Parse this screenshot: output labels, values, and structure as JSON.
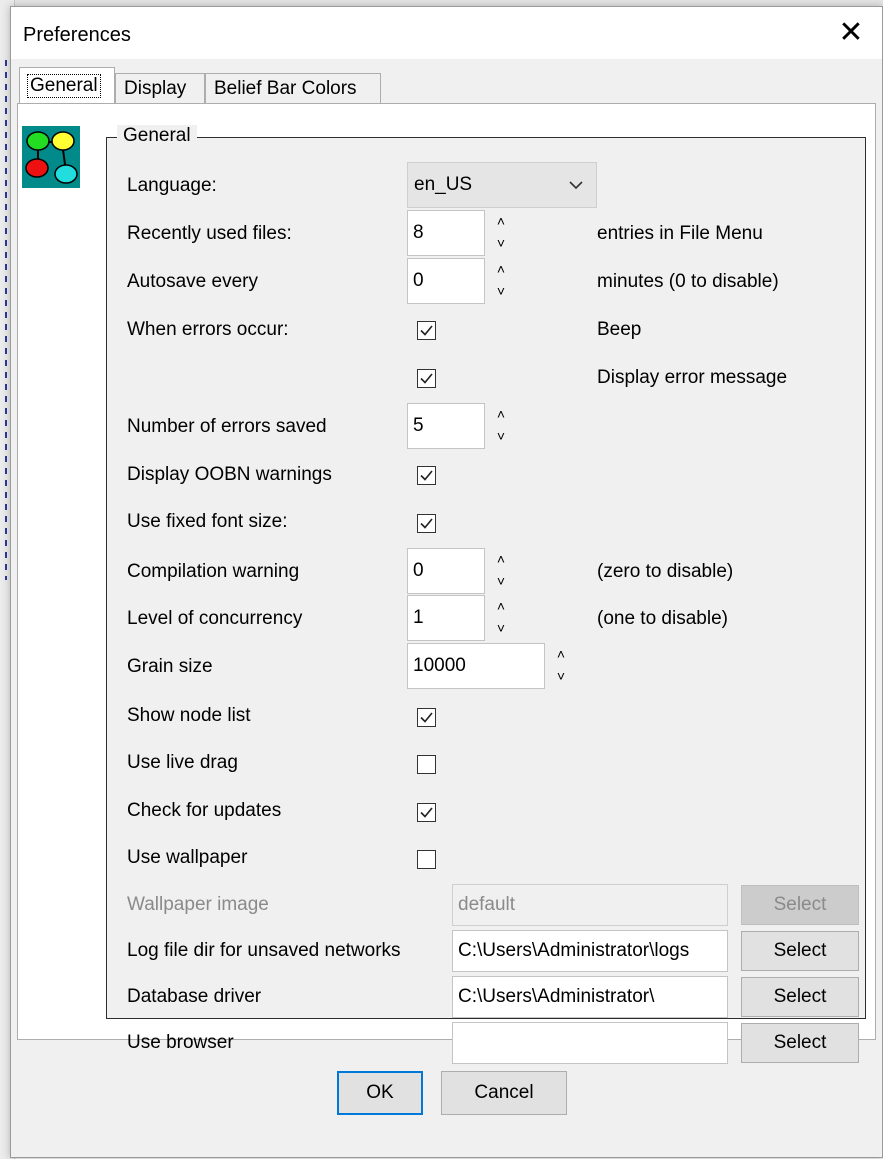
{
  "window": {
    "title": "Preferences",
    "close_glyph": "✕"
  },
  "tabs": [
    {
      "label": "General",
      "active": true
    },
    {
      "label": "Display",
      "active": false
    },
    {
      "label": "Belief Bar Colors",
      "active": false
    }
  ],
  "group": {
    "legend": "General",
    "language": {
      "label": "Language:",
      "value": "en_US",
      "icon": "chevron-down-icon"
    },
    "recent_files": {
      "label": "Recently used files:",
      "value": "8",
      "note": "entries in File Menu"
    },
    "autosave": {
      "label": "Autosave every",
      "value": "0",
      "note": "minutes (0 to disable)"
    },
    "errors_occur": {
      "label": "When errors occur:",
      "beep": {
        "checked": true,
        "note": "Beep"
      },
      "display_message": {
        "checked": true,
        "note": "Display error message"
      }
    },
    "errors_saved": {
      "label": "Number of errors saved",
      "value": "5"
    },
    "oobn_warnings": {
      "label": "Display OOBN warnings",
      "checked": true
    },
    "fixed_font": {
      "label": "Use fixed font size:",
      "checked": true
    },
    "compilation_warning": {
      "label": "Compilation warning",
      "value": "0",
      "note": "(zero to disable)"
    },
    "concurrency": {
      "label": "Level of concurrency",
      "value": "1",
      "note": "(one to disable)"
    },
    "grain_size": {
      "label": "Grain size",
      "value": "10000"
    },
    "node_list": {
      "label": "Show node list",
      "checked": true
    },
    "live_drag": {
      "label": "Use live drag",
      "checked": false
    },
    "check_updates": {
      "label": "Check for updates",
      "checked": true
    },
    "wallpaper": {
      "label": "Use wallpaper",
      "checked": false
    },
    "wallpaper_image": {
      "label": "Wallpaper image",
      "value": "default",
      "button": "Select",
      "disabled": true
    },
    "log_dir": {
      "label": "Log file dir for unsaved networks",
      "value": "C:\\Users\\Administrator\\logs",
      "button": "Select"
    },
    "db_driver": {
      "label": "Database driver",
      "value": "C:\\Users\\Administrator\\",
      "button": "Select"
    },
    "browser": {
      "label": "Use browser",
      "value": "",
      "button": "Select"
    }
  },
  "buttons": {
    "ok": "OK",
    "cancel": "Cancel"
  },
  "colors": {
    "accent": "#0078d7",
    "dialog_bg": "#f0f0f0",
    "disabled_text": "#8a8a8a"
  }
}
